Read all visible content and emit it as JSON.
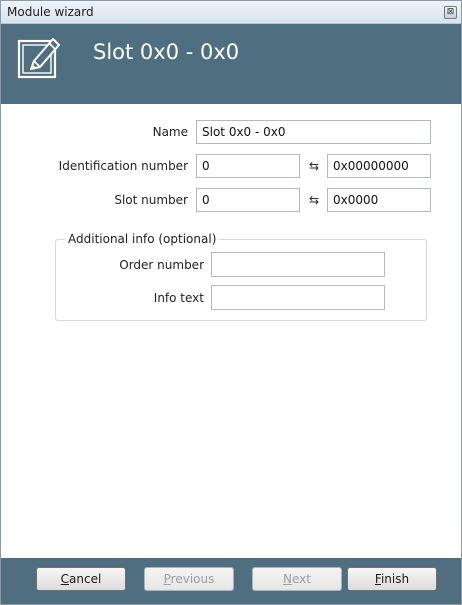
{
  "window": {
    "title": "Module wizard",
    "close_glyph": "⊠"
  },
  "header": {
    "title": "Slot 0x0 - 0x0",
    "icon": "edit-pencil-icon"
  },
  "form": {
    "name": {
      "label": "Name",
      "value": "Slot 0x0 - 0x0"
    },
    "identification_number": {
      "label": "Identification number",
      "value": "0",
      "hex_value": "0x00000000"
    },
    "slot_number": {
      "label": "Slot number",
      "value": "0",
      "hex_value": "0x0000"
    },
    "swap_glyph": "⇆"
  },
  "additional_info": {
    "legend": "Additional info (optional)",
    "order_number": {
      "label": "Order number",
      "value": ""
    },
    "info_text": {
      "label": "Info text",
      "value": ""
    }
  },
  "buttons": {
    "cancel": {
      "first": "C",
      "rest": "ancel"
    },
    "previous": {
      "first": "P",
      "rest": "revious"
    },
    "next": {
      "first": "N",
      "rest": "ext"
    },
    "finish": {
      "first": "F",
      "rest": "inish"
    }
  },
  "colors": {
    "header_bg": "#4f6e80",
    "footer_bg": "#4f6e80"
  }
}
